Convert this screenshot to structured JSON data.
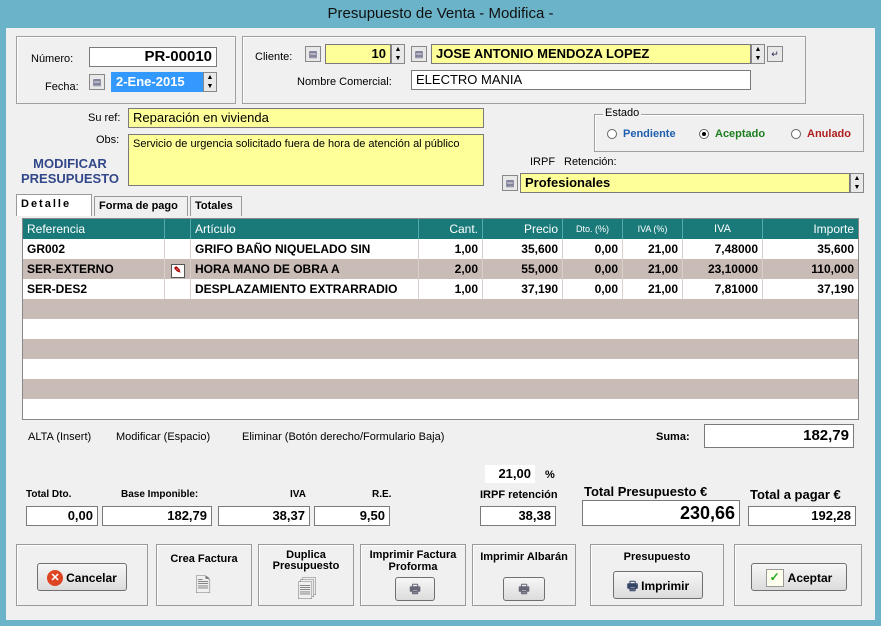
{
  "window": {
    "title": "Presupuesto de Venta - Modifica -"
  },
  "header": {
    "numero_label": "Número:",
    "numero_value": "PR-00010",
    "fecha_label": "Fecha:",
    "fecha_value": "2-Ene-2015",
    "cliente_label": "Cliente:",
    "cliente_code": "10",
    "cliente_name": "JOSE ANTONIO MENDOZA LOPEZ",
    "nombre_comercial_label": "Nombre Comercial:",
    "nombre_comercial_value": "ELECTRO MANIA"
  },
  "info": {
    "suref_label": "Su ref:",
    "suref_value": "Reparación en vivienda",
    "obs_label": "Obs:",
    "obs_value": "Servicio de urgencia solicitado fuera de hora de atención al público",
    "mode_line1": "MODIFICAR",
    "mode_line2": "PRESUPUESTO"
  },
  "estado": {
    "title": "Estado",
    "options": [
      {
        "label": "Pendiente",
        "color": "#1f5fb0",
        "selected": false
      },
      {
        "label": "Aceptado",
        "color": "#1e7d1e",
        "selected": true
      },
      {
        "label": "Anulado",
        "color": "#b01f1f",
        "selected": false
      }
    ]
  },
  "irpf": {
    "irpf_label": "IRPF",
    "retencion_label": "Retención:",
    "value": "Profesionales"
  },
  "tabs": [
    "Detalle",
    "Forma de pago",
    "Totales"
  ],
  "grid": {
    "headers": [
      "Referencia",
      "",
      "Artículo",
      "Cant.",
      "Precio",
      "Dto. (%)",
      "IVA (%)",
      "IVA",
      "Importe"
    ],
    "rows": [
      [
        "GR002",
        "",
        "GRIFO BAÑO NIQUELADO SIN",
        "1,00",
        "35,600",
        "0,00",
        "21,00",
        "7,48000",
        "35,600"
      ],
      [
        "SER-EXTERNO",
        "edit",
        "HORA MANO DE OBRA A",
        "2,00",
        "55,000",
        "0,00",
        "21,00",
        "23,10000",
        "110,000"
      ],
      [
        "SER-DES2",
        "",
        "DESPLAZAMIENTO EXTRARRADIO",
        "1,00",
        "37,190",
        "0,00",
        "21,00",
        "7,81000",
        "37,190"
      ]
    ],
    "empty_rows": 6
  },
  "hints": {
    "alta": "ALTA (Insert)",
    "modificar": "Modificar (Espacio)",
    "eliminar": "Eliminar (Botón derecho/Formulario Baja)"
  },
  "suma": {
    "label": "Suma:",
    "value": "182,79"
  },
  "totals": {
    "irpf_pct": "21,00",
    "pct_sign": "%",
    "total_dto_label": "Total Dto.",
    "total_dto": "0,00",
    "base_label": "Base Imponible:",
    "base": "182,79",
    "iva_label": "IVA",
    "iva": "38,37",
    "re_label": "R.E.",
    "re": "9,50",
    "irpf_ret_label": "IRPF  retención",
    "irpf_ret": "38,38",
    "total_presupuesto_label": "Total Presupuesto  €",
    "total_presupuesto": "230,66",
    "total_pagar_label": "Total a pagar  €",
    "total_pagar": "192,28"
  },
  "buttons": {
    "cancelar": "Cancelar",
    "crea_factura": "Crea Factura",
    "duplica_1": "Duplica",
    "duplica_2": "Presupuesto",
    "imprimir_proforma_1": "Imprimir Factura",
    "imprimir_proforma_2": "Proforma",
    "imprimir_albaran": "Imprimir Albarán",
    "presupuesto_caption": "Presupuesto",
    "imprimir": "Imprimir",
    "aceptar": "Aceptar"
  },
  "colors": {
    "grid_header": "#1a7a7a",
    "yellow_field": "#ffff99",
    "alt_row": "#c9bcb6",
    "titlebar": "#6ab3c8"
  }
}
